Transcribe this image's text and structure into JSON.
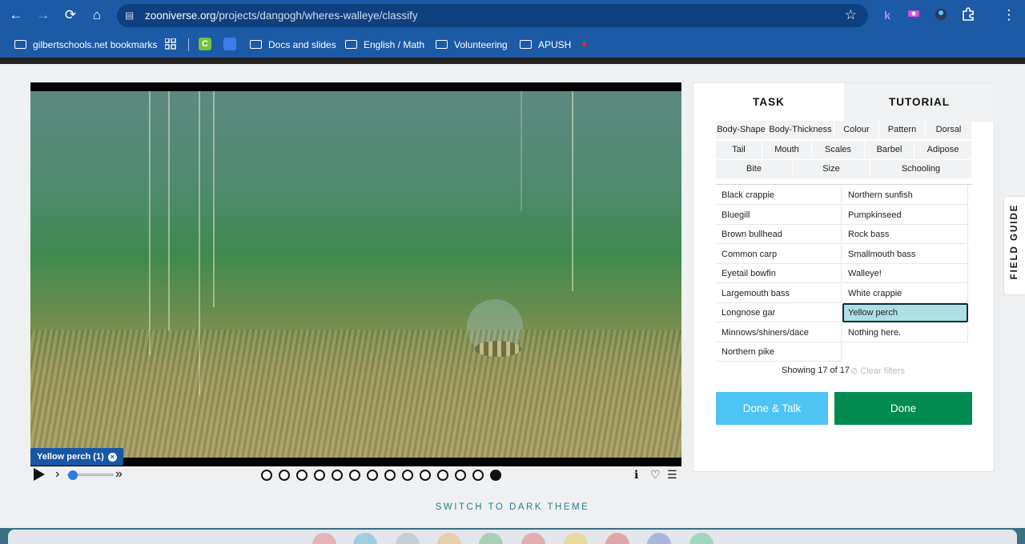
{
  "browser": {
    "url_domain": "zooniverse.org",
    "url_path": "/projects/dangogh/wheres-walleye/classify",
    "nav_back": "←",
    "nav_forward": "→",
    "nav_reload": "⟳",
    "nav_home": "⌂",
    "star": "☆",
    "menu": "⋮",
    "ext_k": "k"
  },
  "bookmarks": {
    "managed": "gilbertschools.net bookmarks",
    "items": [
      "Docs and slides",
      "English / Math",
      "Volunteering",
      "APUSH"
    ]
  },
  "viewer": {
    "tag_label": "Yellow perch (1)",
    "tag_close": "×",
    "frames_total": 14,
    "frame_active": 14,
    "speed_level": 0.1,
    "info_icon": "ℹ",
    "heart_icon": "♡",
    "list_icon": "☰",
    "rewind_glyph": "›",
    "ff_glyph": "»"
  },
  "task_panel": {
    "tabs": [
      "TASK",
      "TUTORIAL"
    ],
    "filters_row1": [
      "Body-Shape",
      "Body-Thickness",
      "Colour",
      "Pattern",
      "Dorsal"
    ],
    "filters_row2": [
      "Tail",
      "Mouth",
      "Scales",
      "Barbel",
      "Adipose"
    ],
    "filters_row3": [
      "Bite",
      "Size",
      "Schooling"
    ],
    "choices_left": [
      "Black crappie",
      "Bluegill",
      "Brown bullhead",
      "Common carp",
      "Eyetail bowfin",
      "Largemouth bass",
      "Longnose gar",
      "Minnows/shiners/dace",
      "Northern pike"
    ],
    "choices_right": [
      "Northern sunfish",
      "Pumpkinseed",
      "Rock bass",
      "Smallmouth bass",
      "Walleye!",
      "White crappie",
      "Yellow perch",
      "Nothing here."
    ],
    "selected_choice": "Yellow perch",
    "showing": "Showing 17 of 17",
    "clear_filters": "⊘ Clear filters",
    "done_talk": "Done & Talk",
    "done": "Done"
  },
  "field_guide": "FIELD GUIDE",
  "dark_theme": "SWITCH TO DARK THEME",
  "colors": {
    "chrome": "#1c5aa6",
    "done": "#008a50",
    "done_talk": "#4ec4f5",
    "selected": "#addfe4"
  }
}
